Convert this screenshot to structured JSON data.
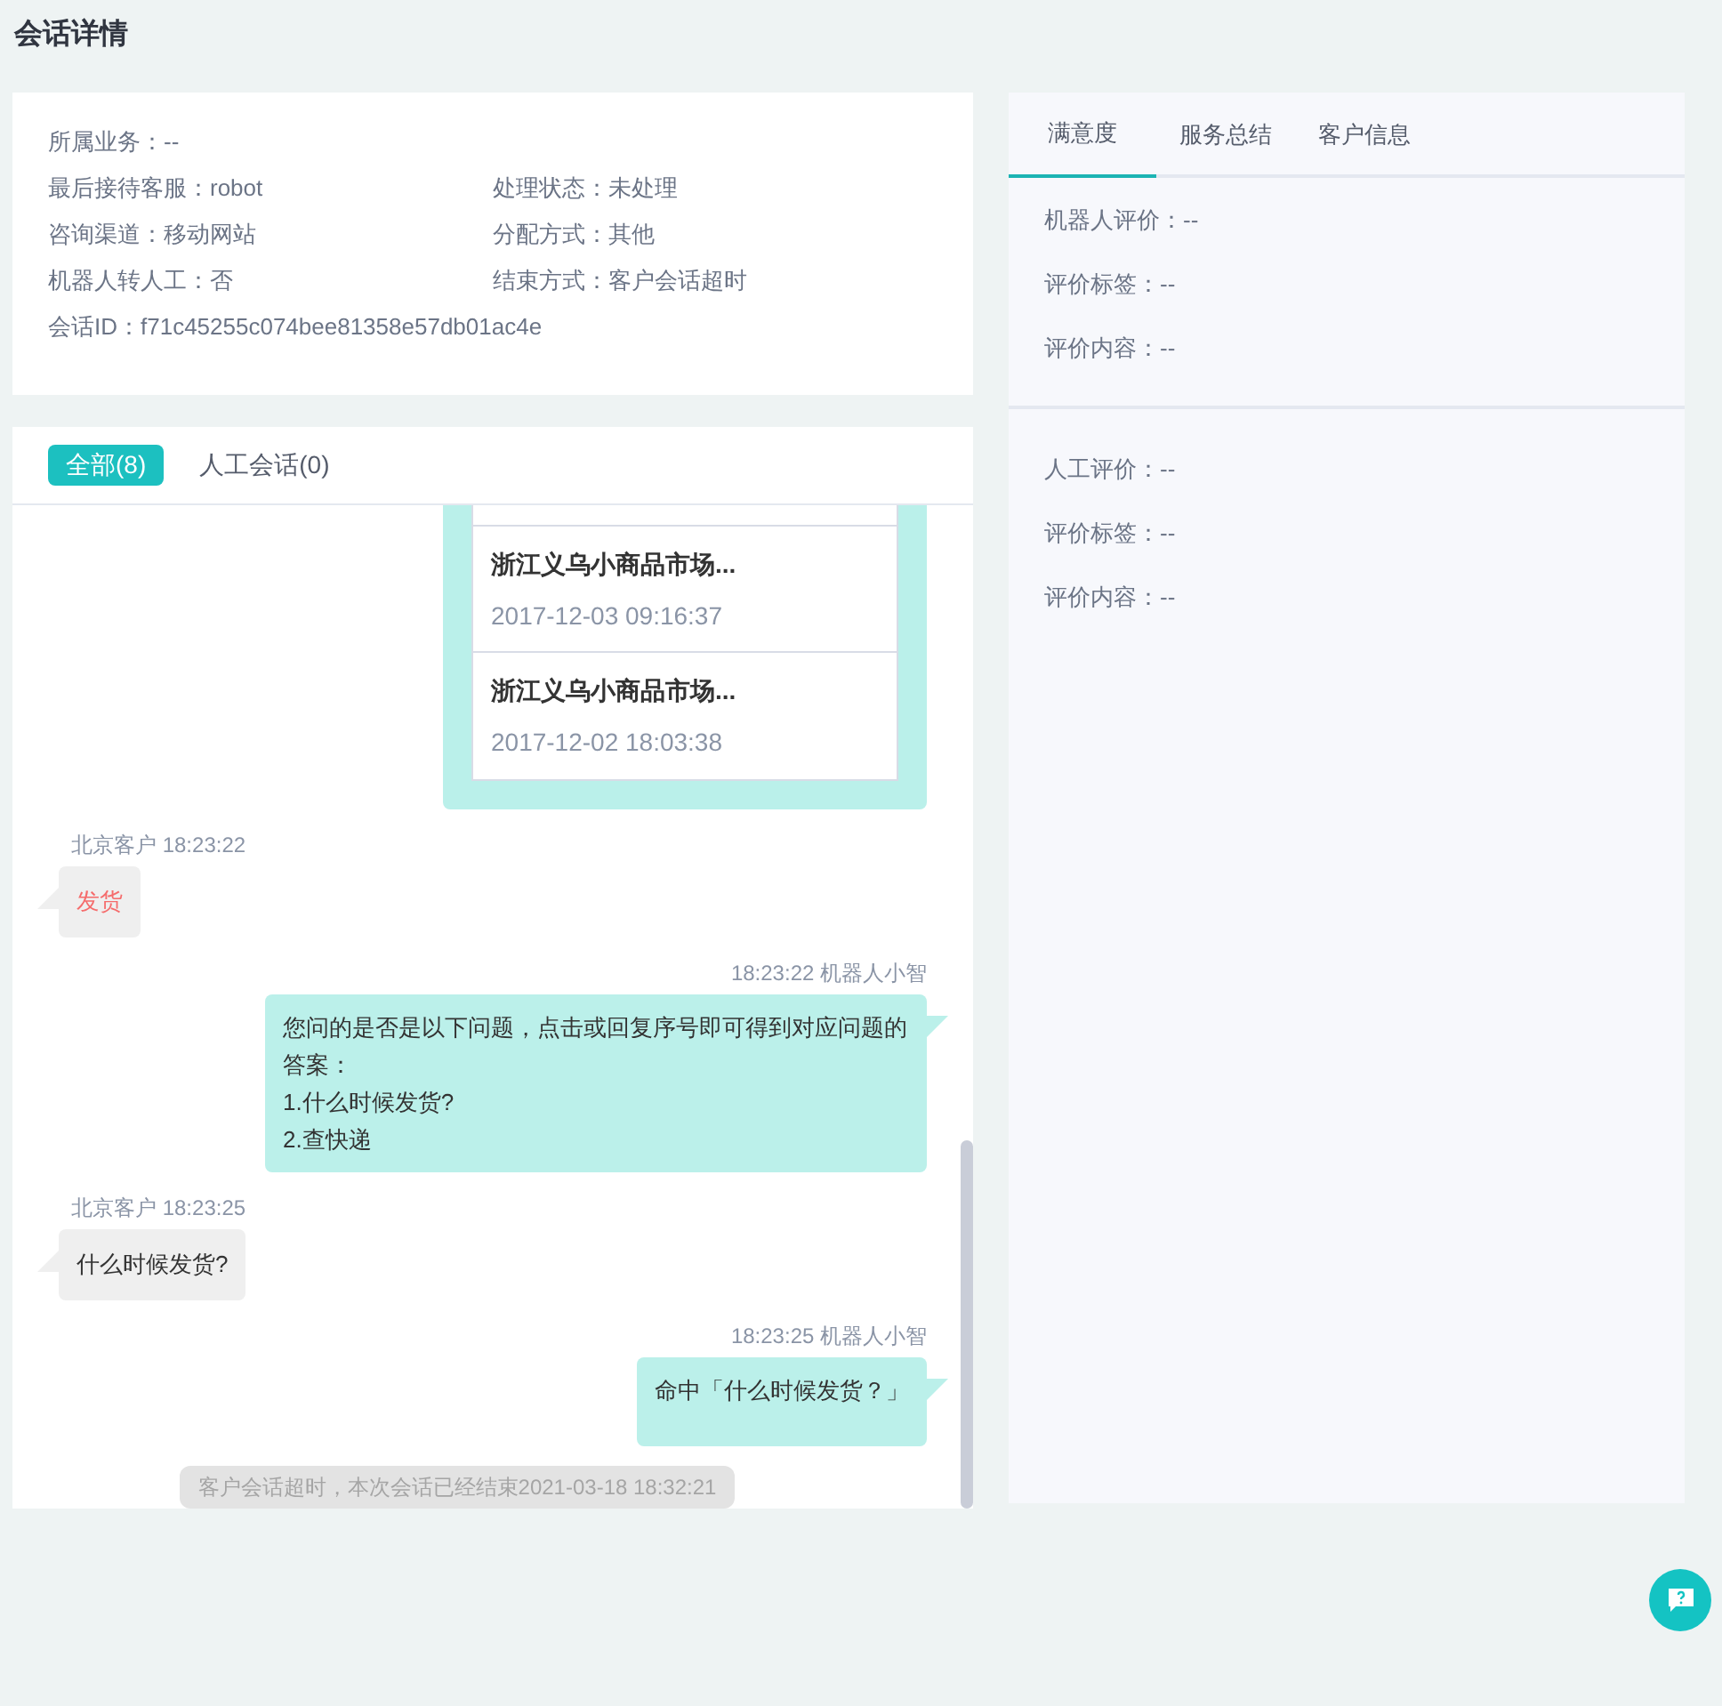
{
  "page_title": "会话详情",
  "info_rows": [
    [
      {
        "label": "所属业务：",
        "value": "--"
      }
    ],
    [
      {
        "label": "最后接待客服：",
        "value": "robot"
      },
      {
        "label": "处理状态：",
        "value": "未处理"
      }
    ],
    [
      {
        "label": "咨询渠道：",
        "value": "移动网站"
      },
      {
        "label": "分配方式：",
        "value": "其他"
      }
    ],
    [
      {
        "label": "机器人转人工：",
        "value": "否"
      },
      {
        "label": "结束方式：",
        "value": "客户会话超时"
      }
    ],
    [
      {
        "label": "会话ID：",
        "value": "f71c45255c074bee81358e57db01ac4e"
      }
    ]
  ],
  "chat": {
    "tabs": [
      {
        "label": "全部(8)",
        "selected": true
      },
      {
        "label": "人工会话(0)",
        "selected": false
      }
    ],
    "messages": [
      {
        "kind": "product_list",
        "items": [
          {
            "title": "浙江义乌小商品市场...",
            "time": "2017-12-03 09:16:37"
          },
          {
            "title": "浙江义乌小商品市场...",
            "time": "2017-12-02 18:03:38"
          }
        ]
      },
      {
        "kind": "customer",
        "meta": "北京客户 18:23:22",
        "lines": [
          "发货"
        ],
        "highlighted": true
      },
      {
        "kind": "bot",
        "meta": "18:23:22 机器人小智",
        "lines": [
          "您问的是否是以下问题，点击或回复序号即可得到对应问题的答案：",
          "1.什么时候发货?",
          "2.查快递"
        ]
      },
      {
        "kind": "customer",
        "meta": "北京客户 18:23:25",
        "lines": [
          "什么时候发货?"
        ],
        "highlighted": false
      },
      {
        "kind": "bot",
        "meta": "18:23:25 机器人小智",
        "lines": [
          "命中「什么时候发货？」"
        ]
      }
    ],
    "notice": "客户会话超时，本次会话已经结束2021-03-18 18:32:21"
  },
  "side": {
    "tabs": [
      {
        "label": "满意度",
        "selected": true
      },
      {
        "label": "服务总结",
        "selected": false
      },
      {
        "label": "客户信息",
        "selected": false
      }
    ],
    "sections": [
      [
        "机器人评价：--",
        "评价标签：--",
        "评价内容：--"
      ],
      [
        "人工评价：--",
        "评价标签：--",
        "评价内容：--"
      ]
    ]
  }
}
